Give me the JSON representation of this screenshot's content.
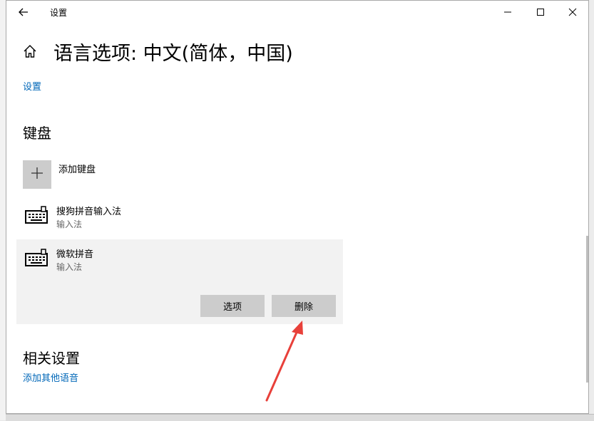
{
  "window": {
    "app_title": "设置",
    "page_title": "语言选项: 中文(简体，中国)"
  },
  "top_link": "设置",
  "keyboard": {
    "heading": "键盘",
    "add_label": "添加键盘",
    "items": [
      {
        "name": "搜狗拼音输入法",
        "type": "输入法"
      },
      {
        "name": "微软拼音",
        "type": "输入法"
      }
    ],
    "options_label": "选项",
    "remove_label": "删除"
  },
  "related": {
    "heading": "相关设置",
    "add_language_link": "添加其他语音"
  },
  "colors": {
    "accent_link": "#0067b8",
    "annotation_arrow": "#e8403a"
  }
}
